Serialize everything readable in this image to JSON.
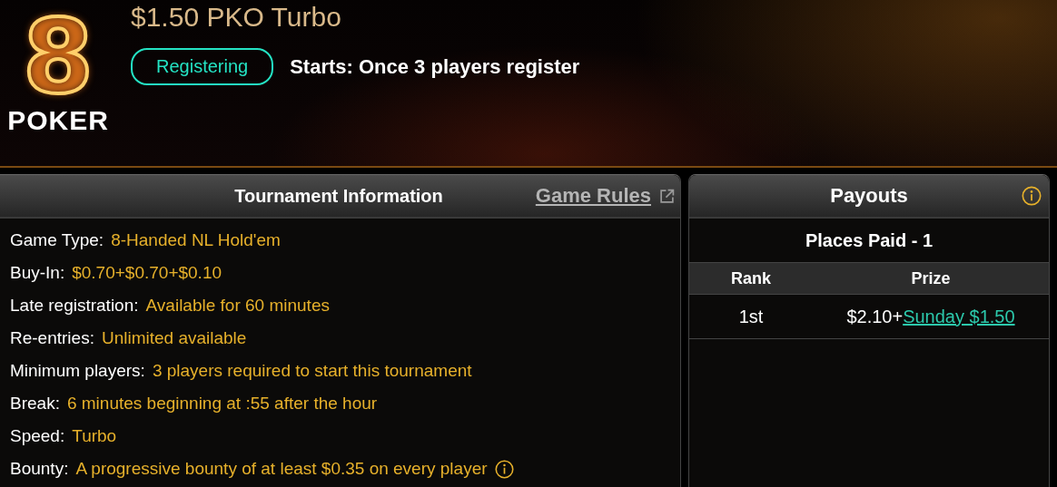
{
  "logo": {
    "mark": "8",
    "wordmark": "POKER"
  },
  "tournament": {
    "title": "$1.50 PKO Turbo",
    "status": "Registering",
    "starts": "Starts: Once 3 players register"
  },
  "info_panel": {
    "title": "Tournament Information",
    "link": "Game Rules",
    "rows": [
      {
        "label": "Game Type:",
        "value": "8-Handed NL Hold'em",
        "info": false
      },
      {
        "label": "Buy-In:",
        "value": "$0.70+$0.70+$0.10",
        "info": false
      },
      {
        "label": "Late registration:",
        "value": "Available for 60 minutes",
        "info": false
      },
      {
        "label": "Re-entries:",
        "value": "Unlimited available",
        "info": false
      },
      {
        "label": "Minimum players:",
        "value": "3 players required to start this tournament",
        "info": false
      },
      {
        "label": "Break:",
        "value": "6 minutes beginning at :55 after the hour",
        "info": false
      },
      {
        "label": "Speed:",
        "value": "Turbo",
        "info": false
      },
      {
        "label": "Bounty:",
        "value": "A progressive bounty of at least $0.35 on every player",
        "info": true
      }
    ]
  },
  "payouts": {
    "title": "Payouts",
    "places_paid": "Places Paid - 1",
    "columns": [
      "Rank",
      "Prize"
    ],
    "rows": [
      {
        "rank": "1st",
        "amount": "$2.10+",
        "link": "Sunday $1.50"
      }
    ]
  }
}
